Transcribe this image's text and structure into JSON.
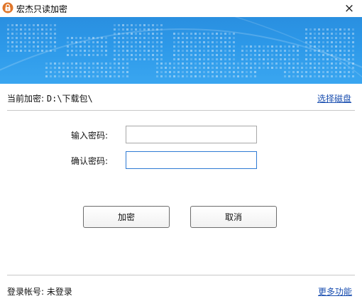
{
  "window": {
    "title": "宏杰只读加密",
    "close_glyph": "×",
    "app_icon": "padlock-icon",
    "accent_color": "#d2691e"
  },
  "banner": {
    "description_colors": {
      "top": "#2a8fe0",
      "bottom": "#3aa6f0"
    }
  },
  "path": {
    "label": "当前加密:",
    "value": "D:\\下载包\\",
    "select_disk_link": "选择磁盘"
  },
  "form": {
    "password_label": "输入密码:",
    "password_value": "",
    "confirm_label": "确认密码:",
    "confirm_value": ""
  },
  "buttons": {
    "encrypt": "加密",
    "cancel": "取消"
  },
  "footer": {
    "account_label": "登录帐号:",
    "account_value": "未登录",
    "more_link": "更多功能"
  }
}
